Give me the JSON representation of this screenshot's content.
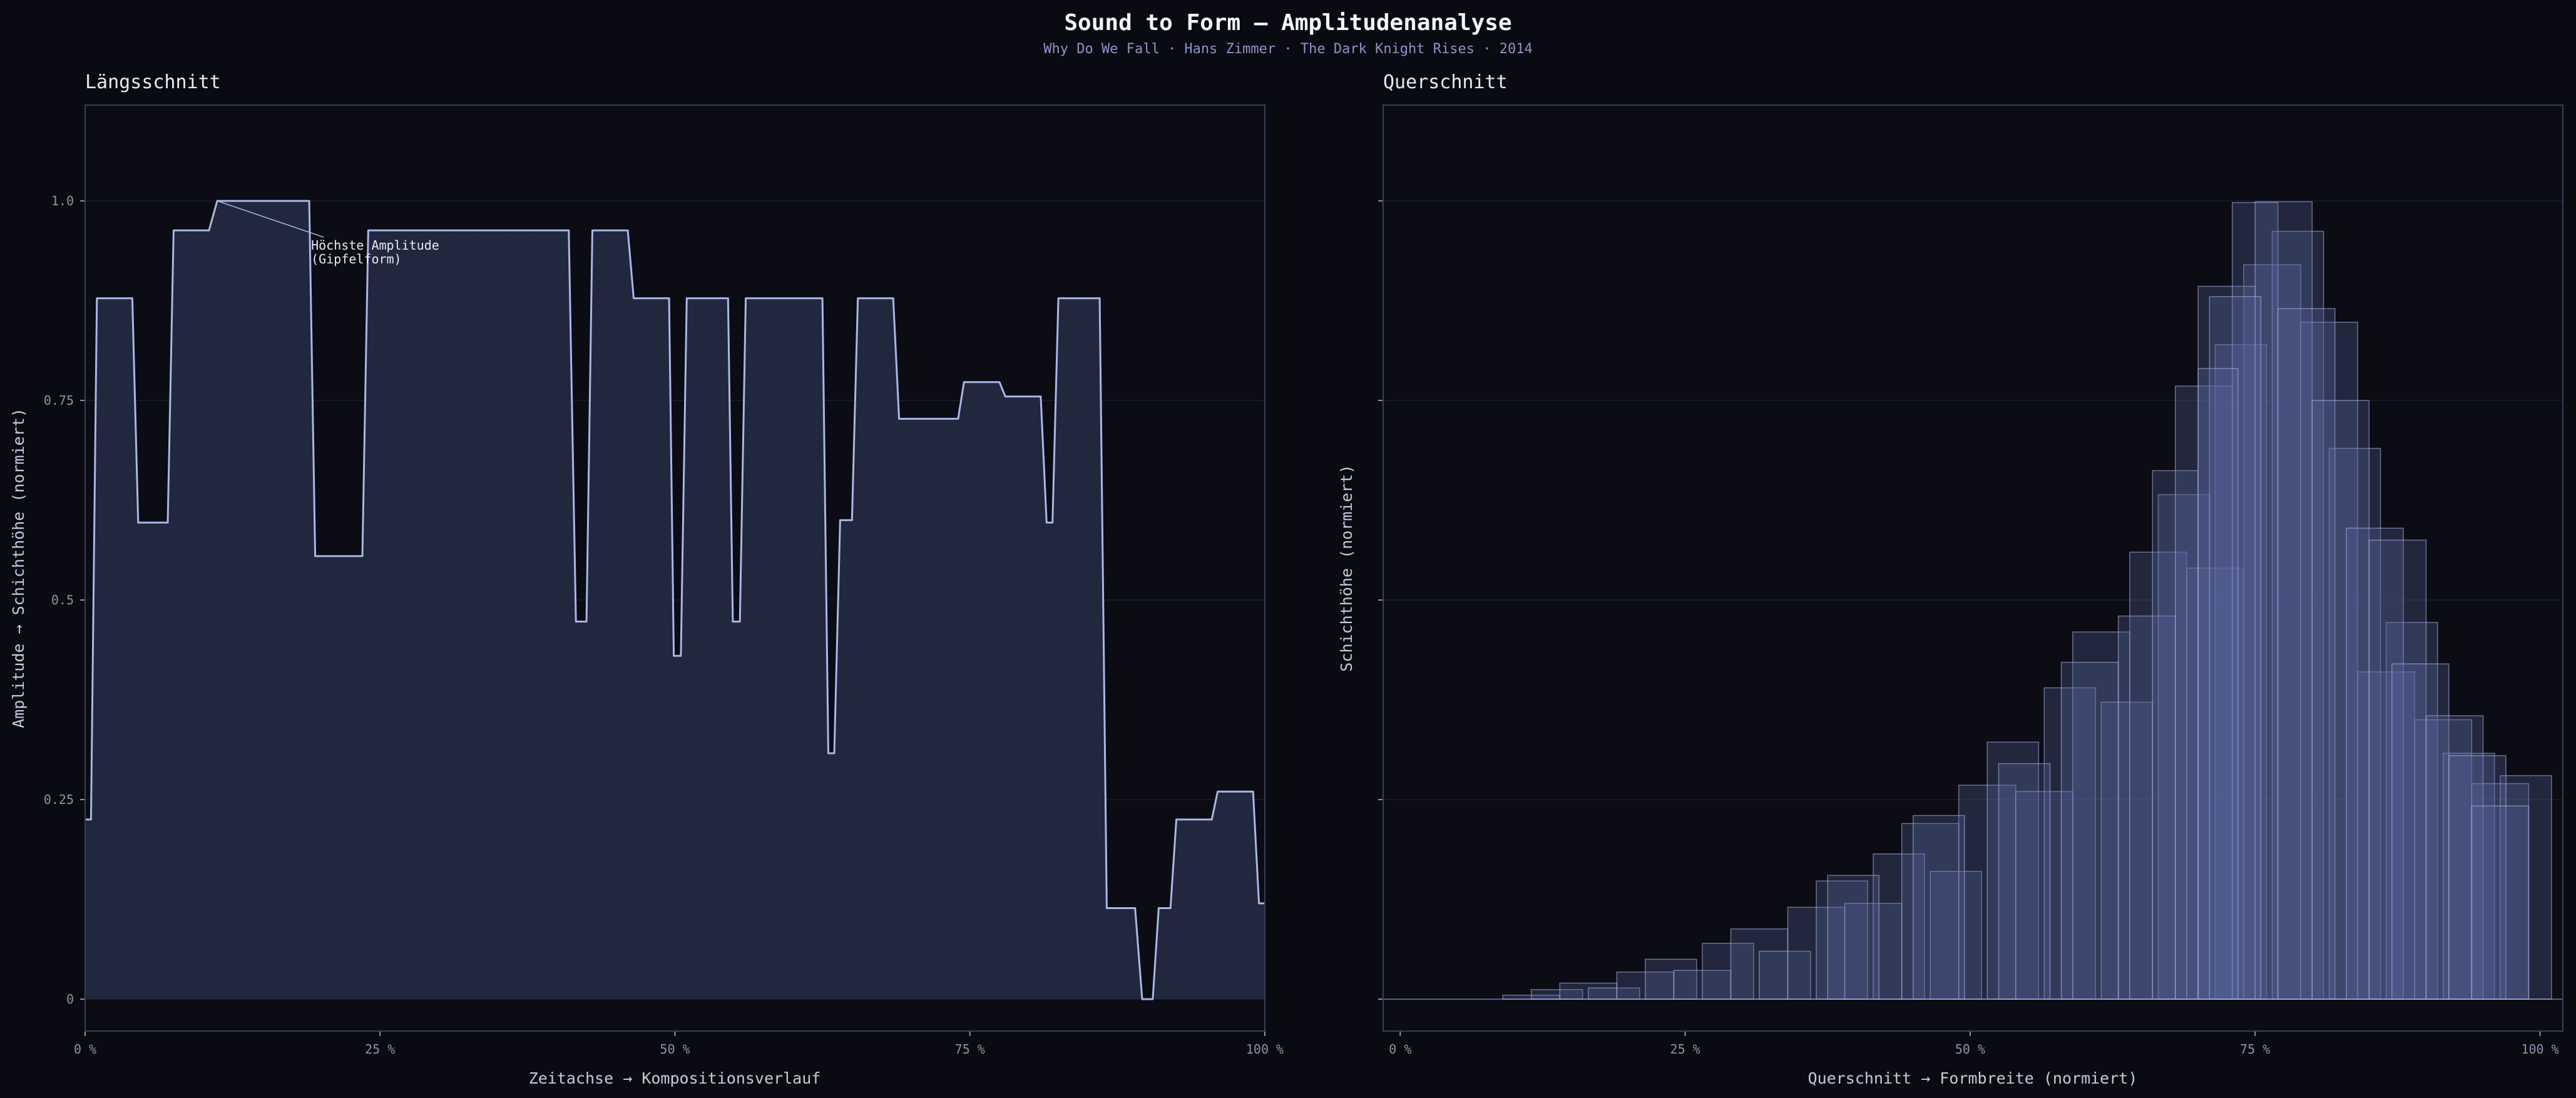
{
  "title": "Sound to Form — Amplitudenanalyse",
  "subtitle": "Why Do We Fall  ·  Hans Zimmer  ·  The Dark Knight Rises  ·  2014",
  "colors": {
    "background": "#0a0b12",
    "panel": "#0b0c14",
    "frame": "#3a3e58",
    "grid": "#1a1d2c",
    "line": "#a9b6ea",
    "area_fill": "#232a40",
    "block_fill": "#5a68a0",
    "block_stroke": "#aeb8ea",
    "text": "#e8ecf8",
    "muted": "#8c91ad"
  },
  "chart_data": [
    {
      "type": "area",
      "panel_title": "Längsschnitt",
      "xlabel": "Zeitachse  →  Kompositionsverlauf",
      "ylabel": "Amplitude  →  Schichthöhe (normiert)",
      "xlim": [
        0,
        100
      ],
      "ylim": [
        -0.04,
        1.12
      ],
      "x_ticks": [
        0,
        25,
        50,
        75,
        100
      ],
      "x_tick_labels": [
        "0 %",
        "25 %",
        "50 %",
        "75 %",
        "100 %"
      ],
      "y_ticks": [
        0,
        0.25,
        0.5,
        0.75,
        1.0
      ],
      "y_tick_labels": [
        "0",
        "0.25",
        "0.5",
        "0.75",
        "1.0"
      ],
      "grid": true,
      "x": [
        0,
        0.5,
        1,
        4,
        4.5,
        7,
        7.5,
        10.5,
        11.2,
        19,
        19.5,
        23.5,
        24,
        41,
        41.6,
        42.5,
        43,
        46,
        46.5,
        49.5,
        49.9,
        50.5,
        51,
        54.5,
        54.9,
        55.5,
        56,
        62.5,
        63,
        63.5,
        64,
        65,
        65.5,
        68.5,
        69,
        74,
        74.5,
        77.5,
        78,
        81,
        81.5,
        82,
        82.5,
        86,
        86.6,
        89,
        89.6,
        90.5,
        91,
        92,
        92.5,
        95.5,
        96,
        99,
        99.5,
        100
      ],
      "y": [
        0.225,
        0.225,
        0.878,
        0.878,
        0.597,
        0.597,
        0.963,
        0.963,
        1.0,
        1.0,
        0.555,
        0.555,
        0.963,
        0.963,
        0.473,
        0.473,
        0.963,
        0.963,
        0.878,
        0.878,
        0.43,
        0.43,
        0.878,
        0.878,
        0.473,
        0.473,
        0.878,
        0.878,
        0.308,
        0.308,
        0.6,
        0.6,
        0.878,
        0.878,
        0.727,
        0.727,
        0.773,
        0.773,
        0.755,
        0.755,
        0.597,
        0.597,
        0.878,
        0.878,
        0.114,
        0.114,
        0.0,
        0.0,
        0.114,
        0.114,
        0.225,
        0.225,
        0.26,
        0.26,
        0.12,
        0.12
      ],
      "annotation": {
        "text_lines": [
          "Höchste Amplitude",
          "(Gipfelform)"
        ],
        "x": 11.2,
        "y": 1.0
      }
    },
    {
      "type": "bar",
      "panel_title": "Querschnitt",
      "xlabel": "Querschnitt  →  Formbreite (normiert)",
      "ylabel": "Schichthöhe (normiert)",
      "xlim": [
        -1.5,
        102
      ],
      "ylim": [
        -0.04,
        1.12
      ],
      "x_ticks": [
        0,
        25,
        50,
        75,
        100
      ],
      "x_tick_labels": [
        "0 %",
        "25 %",
        "50 %",
        "75 %",
        "100 %"
      ],
      "y_ticks": [
        0,
        0.25,
        0.5,
        0.75,
        1.0
      ],
      "y_tick_labels": [
        "",
        "",
        "",
        "",
        ""
      ],
      "grid": true,
      "blocks": [
        {
          "x0": 9.0,
          "x1": 14,
          "h": 0.005
        },
        {
          "x0": 11.5,
          "x1": 16,
          "h": 0.012
        },
        {
          "x0": 14.0,
          "x1": 19,
          "h": 0.02
        },
        {
          "x0": 16.5,
          "x1": 21,
          "h": 0.014
        },
        {
          "x0": 19.0,
          "x1": 24,
          "h": 0.034
        },
        {
          "x0": 21.5,
          "x1": 26,
          "h": 0.05
        },
        {
          "x0": 24.0,
          "x1": 29,
          "h": 0.036
        },
        {
          "x0": 26.5,
          "x1": 31,
          "h": 0.07
        },
        {
          "x0": 29.0,
          "x1": 34,
          "h": 0.088
        },
        {
          "x0": 31.5,
          "x1": 36,
          "h": 0.06
        },
        {
          "x0": 34.0,
          "x1": 39,
          "h": 0.115
        },
        {
          "x0": 36.5,
          "x1": 41,
          "h": 0.148
        },
        {
          "x0": 39.0,
          "x1": 44,
          "h": 0.12
        },
        {
          "x0": 41.5,
          "x1": 46,
          "h": 0.182
        },
        {
          "x0": 44.0,
          "x1": 49,
          "h": 0.22
        },
        {
          "x0": 46.5,
          "x1": 51,
          "h": 0.16
        },
        {
          "x0": 49.0,
          "x1": 54,
          "h": 0.268
        },
        {
          "x0": 51.5,
          "x1": 56,
          "h": 0.322
        },
        {
          "x0": 54.0,
          "x1": 59,
          "h": 0.26
        },
        {
          "x0": 56.5,
          "x1": 61,
          "h": 0.39
        },
        {
          "x0": 59.0,
          "x1": 64,
          "h": 0.46
        },
        {
          "x0": 61.5,
          "x1": 66,
          "h": 0.372
        },
        {
          "x0": 64.0,
          "x1": 69,
          "h": 0.56
        },
        {
          "x0": 66.5,
          "x1": 71,
          "h": 0.632
        },
        {
          "x0": 69.0,
          "x1": 74,
          "h": 0.54
        },
        {
          "x0": 71.5,
          "x1": 76,
          "h": 0.82
        },
        {
          "x0": 74.0,
          "x1": 79,
          "h": 0.92
        },
        {
          "x0": 76.5,
          "x1": 81,
          "h": 0.962
        },
        {
          "x0": 79.0,
          "x1": 84,
          "h": 0.848
        },
        {
          "x0": 81.5,
          "x1": 86,
          "h": 0.69
        },
        {
          "x0": 84.0,
          "x1": 89,
          "h": 0.41
        },
        {
          "x0": 86.5,
          "x1": 91,
          "h": 0.472
        },
        {
          "x0": 89.0,
          "x1": 94,
          "h": 0.35
        },
        {
          "x0": 91.5,
          "x1": 96,
          "h": 0.308
        },
        {
          "x0": 94.0,
          "x1": 99,
          "h": 0.27
        },
        {
          "x0": 96.5,
          "x1": 101,
          "h": 0.28
        },
        {
          "x0": 37.5,
          "x1": 42,
          "h": 0.155
        },
        {
          "x0": 45.0,
          "x1": 49.5,
          "h": 0.23
        },
        {
          "x0": 52.5,
          "x1": 57,
          "h": 0.295
        },
        {
          "x0": 58.0,
          "x1": 63,
          "h": 0.422
        },
        {
          "x0": 63.0,
          "x1": 68,
          "h": 0.48
        },
        {
          "x0": 66.0,
          "x1": 70,
          "h": 0.662
        },
        {
          "x0": 68.0,
          "x1": 73,
          "h": 0.768
        },
        {
          "x0": 70.0,
          "x1": 75,
          "h": 0.893
        },
        {
          "x0": 73.0,
          "x1": 77,
          "h": 0.998
        },
        {
          "x0": 75.0,
          "x1": 80,
          "h": 0.999
        },
        {
          "x0": 77.0,
          "x1": 82,
          "h": 0.865
        },
        {
          "x0": 80.0,
          "x1": 85,
          "h": 0.75
        },
        {
          "x0": 83.0,
          "x1": 88,
          "h": 0.59
        },
        {
          "x0": 85.0,
          "x1": 90,
          "h": 0.575
        },
        {
          "x0": 87.0,
          "x1": 92,
          "h": 0.42
        },
        {
          "x0": 90.0,
          "x1": 95,
          "h": 0.355
        },
        {
          "x0": 92.0,
          "x1": 97,
          "h": 0.305
        },
        {
          "x0": 94.0,
          "x1": 99,
          "h": 0.242
        },
        {
          "x0": 71.0,
          "x1": 75.5,
          "h": 0.88
        },
        {
          "x0": 70.0,
          "x1": 73.5,
          "h": 0.79
        }
      ]
    }
  ]
}
